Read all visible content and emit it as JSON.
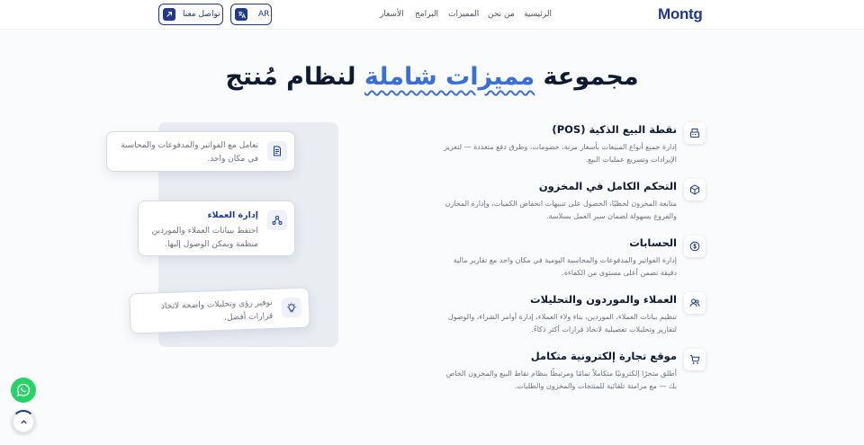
{
  "header": {
    "logo": "Montg",
    "nav": [
      "الرئيسية",
      "من نحن",
      "المميزات",
      "البرامج",
      "الأسعار"
    ],
    "lang_label": "AR",
    "contact_label": "تواصل معنا"
  },
  "hero": {
    "title_part1": "مجموعة",
    "title_highlight": "مميزات شاملة",
    "title_part2": "لنظام مُنتج"
  },
  "features": [
    {
      "title": "نقطة البيع الذكية (POS)",
      "desc": "إدارة جميع أنواع المبيعات بأسعار مرنة، خصومات، وطرق دفع متعددة — لتعزيز الإيرادات وتسريع عمليات البيع.",
      "icon": "pos-icon"
    },
    {
      "title": "التحكم الكامل في المخزون",
      "desc": "متابعة المخزون لحظيًا، الحصول على تنبيهات انخفاض الكميات، وإدارة المخازن والفروع بسهولة لضمان سير العمل بسلاسة.",
      "icon": "box-icon"
    },
    {
      "title": "الحسابات",
      "desc": "إدارة الفواتير والمدفوعات والمحاسبة اليومية في مكان واحد مع تقارير مالية دقيقة تضمن أعلى مستوى من الكفاءة.",
      "icon": "dollar-icon"
    },
    {
      "title": "العملاء والموردون والتحليلات",
      "desc": "تنظيم بيانات العملاء، الموردين، بناء ولاء العملاء، إدارة أوامر الشراء، والوصول لتقارير وتحليلات تفصيلية لاتخاذ قرارات أكثر ذكاءً.",
      "icon": "users-icon"
    },
    {
      "title": "موقع تجارة إلكترونية متكامل",
      "desc": "أطلق متجرًا إلكترونيًا متكاملاً تمامًا ومرتبطًا بنظام نقاط البيع والمخزون الخاص بك — مع مزامنة تلقائية للمنتجات والمخزون والطلبات.",
      "icon": "cart-icon"
    }
  ],
  "cards": {
    "invoices": {
      "text": "تعامل مع الفواتير والمدفوعات والمحاسبة في مكان واحد."
    },
    "customers": {
      "title": "إدارة العملاء",
      "text": "احتفظ ببيانات العملاء والموردين منظمة ويمكن الوصول إليها."
    },
    "insights": {
      "text": "توفير رؤى وتحليلات واضحة لاتخاذ قرارات أفضل."
    }
  },
  "colors": {
    "accent": "#3b6fd8",
    "brand": "#1e3a8a",
    "whatsapp": "#25d366"
  }
}
